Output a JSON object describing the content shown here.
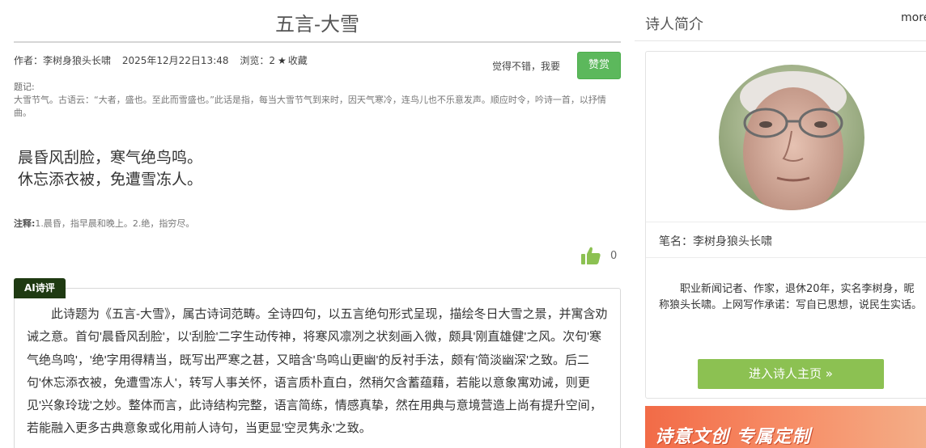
{
  "poem": {
    "title": "五言-大雪",
    "author": "作者：李树身狼头长啸",
    "date": "2025年12月22日13:48",
    "views": "浏览：2",
    "collect": "收藏",
    "praise_prompt": "觉得不错，我要",
    "praise_button": "赞赏",
    "note_label": "题记:",
    "note_text": "大雪节气。古语云：“大者，盛也。至此而雪盛也。”此话是指，每当大雪节气到来时，因天气寒冷，连鸟儿也不乐意发声。顺应时令，吟诗一首，以抒情曲。",
    "lines": [
      "晨昏风刮脸，寒气绝鸟鸣。",
      "休忘添衣被，免遭雪冻人。"
    ],
    "annotation_label": "注释:",
    "annotation_text": "1.晨昏，指早晨和晚上。2.绝，指穷尽。",
    "likes": "0"
  },
  "ai_review": {
    "badge": "AI诗评",
    "text": "此诗题为《五言-大雪》，属古诗词范畴。全诗四句，以五言绝句形式呈现，描绘冬日大雪之景，并寓含劝诫之意。首句'晨昏风刮脸'，以'刮脸'二字生动传神，将寒风凛冽之状刻画入微，颇具'刚直雄健'之风。次句'寒气绝鸟鸣'，'绝'字用得精当，既写出严寒之甚，又暗含'鸟鸣山更幽'的反衬手法，颇有'简淡幽深'之致。后二句'休忘添衣被，免遭雪冻人'，转写人事关怀，语言质朴直白，然稍欠含蓄蕴藉，若能以意象寓劝诫，则更见'兴象玲珑'之妙。整体而言，此诗结构完整，语言简练，情感真挚，然在用典与意境营造上尚有提升空间，若能融入更多古典意象或化用前人诗句，当更显'空灵隽永'之致。"
  },
  "sidebar": {
    "title": "诗人简介",
    "more": "more",
    "pen_name": "笔名：李树身狼头长啸",
    "bio": "职业新闻记者、作家，退休20年，实名李树身，昵称狼头长啸。上网写作承诺：写自已思想，说民生实话。",
    "home_button": "进入诗人主页 »",
    "banner_text": "诗意文创  专属定制"
  },
  "colors": {
    "praise_green": "#5cb85c",
    "home_green": "#8cc152",
    "ai_badge": "#1f3a12",
    "banner_orange": "#f26b47"
  }
}
